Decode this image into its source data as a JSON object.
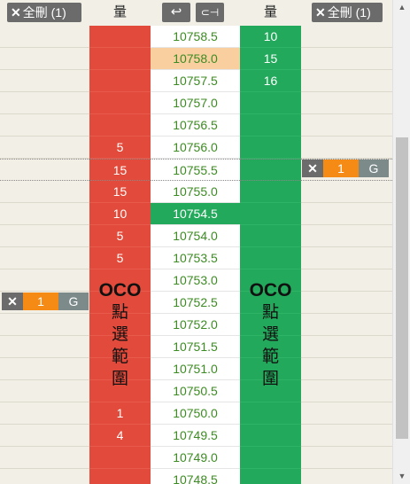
{
  "header": {
    "cancel_all_left": "全刪 (1)",
    "cancel_all_right": "全刪 (1)",
    "bid_qty_label": "量",
    "ask_qty_label": "量",
    "tool_return_icon": "↩",
    "tool_magnet_icon": "⊂⊣"
  },
  "rows": [
    {
      "price": "10758.5",
      "bid": "",
      "ask": "10"
    },
    {
      "price": "10758.0",
      "bid": "",
      "ask": "15",
      "hl": true
    },
    {
      "price": "10757.5",
      "bid": "",
      "ask": "16"
    },
    {
      "price": "10757.0",
      "bid": "",
      "ask": ""
    },
    {
      "price": "10756.5",
      "bid": "",
      "ask": ""
    },
    {
      "price": "10756.0",
      "bid": "5",
      "ask": ""
    },
    {
      "price": "10755.5",
      "bid": "15",
      "ask": "",
      "sel": true
    },
    {
      "price": "10755.0",
      "bid": "15",
      "ask": ""
    },
    {
      "price": "10754.5",
      "bid": "10",
      "ask": "",
      "last": true
    },
    {
      "price": "10754.0",
      "bid": "5",
      "ask": ""
    },
    {
      "price": "10753.5",
      "bid": "5",
      "ask": ""
    },
    {
      "price": "10753.0",
      "bid": "",
      "ask": ""
    },
    {
      "price": "10752.5",
      "bid": "",
      "ask": ""
    },
    {
      "price": "10752.0",
      "bid": "",
      "ask": ""
    },
    {
      "price": "10751.5",
      "bid": "",
      "ask": ""
    },
    {
      "price": "10751.0",
      "bid": "",
      "ask": ""
    },
    {
      "price": "10750.5",
      "bid": "",
      "ask": ""
    },
    {
      "price": "10750.0",
      "bid": "1",
      "ask": ""
    },
    {
      "price": "10749.5",
      "bid": "4",
      "ask": ""
    },
    {
      "price": "10749.0",
      "bid": "",
      "ask": ""
    },
    {
      "price": "10748.5",
      "bid": "",
      "ask": ""
    }
  ],
  "oco": {
    "title": "OCO",
    "chars": [
      "點",
      "選",
      "範",
      "圍"
    ]
  },
  "orders": {
    "right": {
      "x": "✕",
      "qty": "1",
      "g": "G"
    },
    "left": {
      "x": "✕",
      "qty": "1",
      "g": "G"
    }
  },
  "scroll": {
    "up": "▲",
    "down": "▼"
  },
  "colors": {
    "bid": "#e24b3b",
    "ask": "#22a95b",
    "price_text": "#3c8b22",
    "highlight": "#f9cfa0",
    "order_qty": "#f58a14"
  }
}
